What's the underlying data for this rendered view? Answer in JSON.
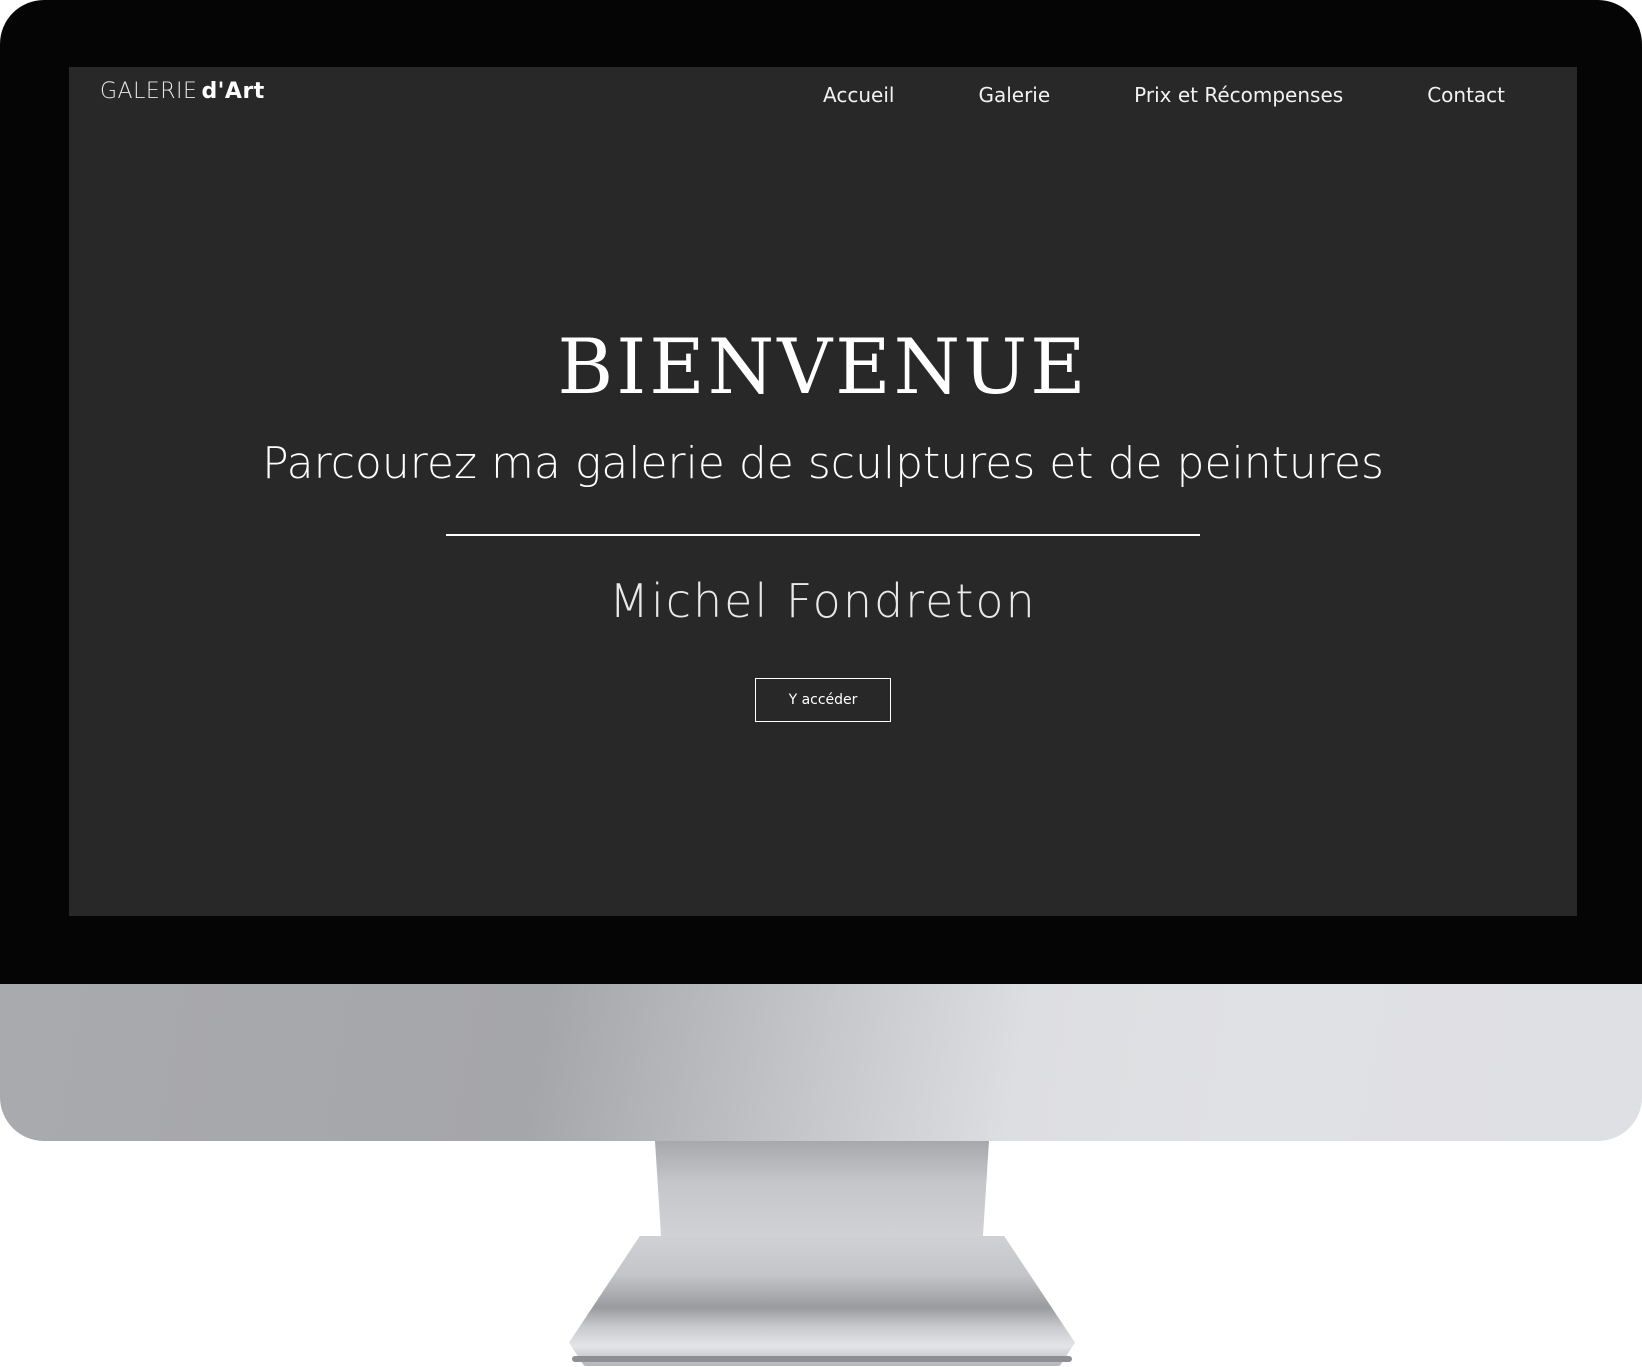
{
  "site": {
    "logo_light": "GALERIE",
    "logo_bold": "d'Art"
  },
  "nav": {
    "items": [
      {
        "label": "Accueil"
      },
      {
        "label": "Galerie"
      },
      {
        "label": "Prix et Récompenses"
      },
      {
        "label": "Contact"
      }
    ]
  },
  "hero": {
    "title": "BIENVENUE",
    "subtitle": "Parcourez ma galerie de sculptures et de peintures",
    "artist": "Michel Fondreton",
    "button_label": "Y accéder"
  },
  "colors": {
    "screen_background": "#282828",
    "text": "#ffffff",
    "bezel": "#050505"
  }
}
